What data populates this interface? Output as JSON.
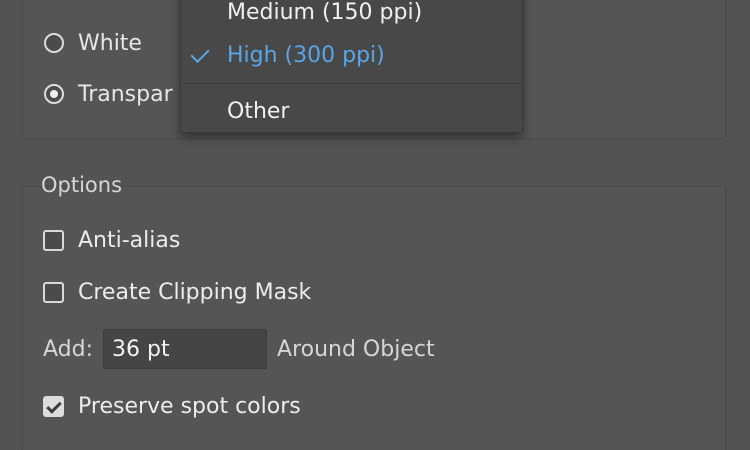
{
  "background_radios": [
    {
      "label": "White",
      "checked": false
    },
    {
      "label": "Transpar",
      "checked": true
    }
  ],
  "options": {
    "legend": "Options",
    "anti_alias": {
      "label": "Anti-alias",
      "checked": false
    },
    "clipping_mask": {
      "label": "Create Clipping Mask",
      "checked": false
    },
    "add": {
      "label": "Add:",
      "value": "36 pt",
      "suffix": "Around Object"
    },
    "spot_colors": {
      "label": "Preserve spot colors",
      "checked": true
    }
  },
  "resolution_menu": {
    "items": [
      {
        "label": "Medium (150 ppi)",
        "selected": false
      },
      {
        "label": "High (300 ppi)",
        "selected": true
      },
      {
        "label": "Other",
        "selected": false
      }
    ],
    "selected_color": "#5aa5e6"
  },
  "colors": {
    "panel_bg": "#535353",
    "menu_bg": "#484848",
    "text": "#e8e8e8",
    "accent": "#5aa5e6"
  }
}
